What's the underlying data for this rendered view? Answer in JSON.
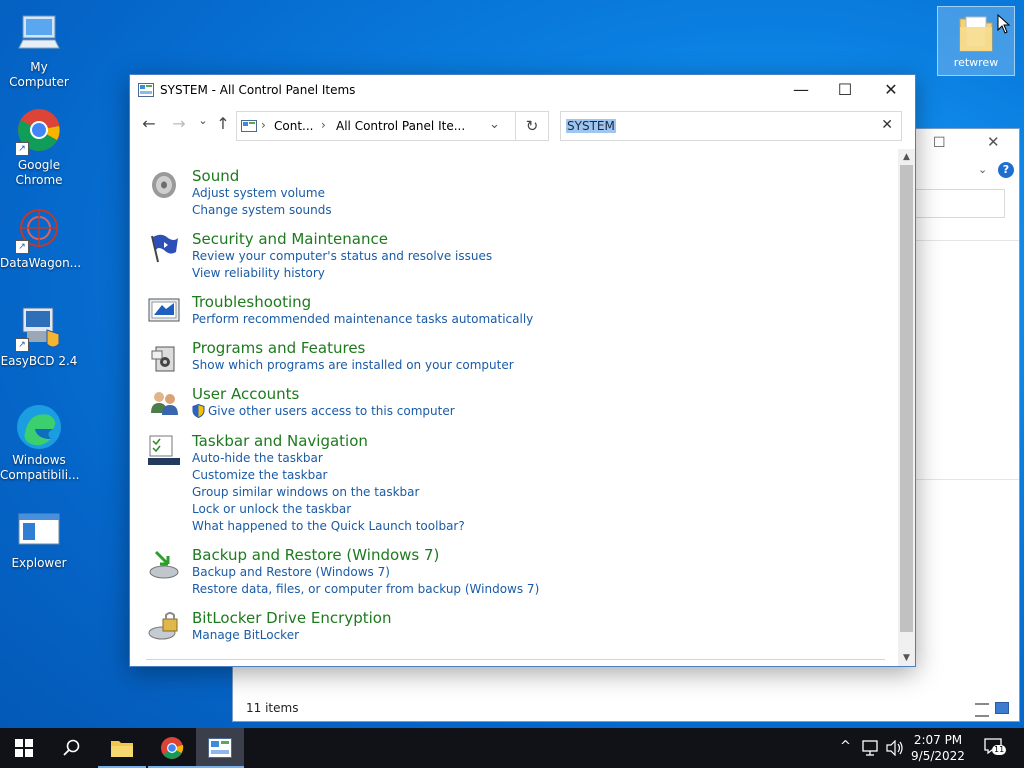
{
  "desktop": {
    "icons": [
      {
        "label": "My Computer",
        "icon": "computer-icon"
      },
      {
        "label": "Google Chrome",
        "icon": "chrome-icon"
      },
      {
        "label": "DataWagon...",
        "icon": "datawagon-icon"
      },
      {
        "label": "EasyBCD 2.4",
        "icon": "easybcd-icon"
      },
      {
        "label": "Windows Compatibili...",
        "icon": "edge-icon"
      },
      {
        "label": "Explower",
        "icon": "explorer-window-icon"
      }
    ],
    "folder": {
      "label": "retwrew",
      "icon": "folder-icon"
    }
  },
  "background_window": {
    "status": "11 items"
  },
  "window": {
    "title": "SYSTEM - All Control Panel Items",
    "minimize": "—",
    "maximize": "☐",
    "close": "✕"
  },
  "nav": {
    "back": "←",
    "forward": "→",
    "recent": "⌄",
    "up": "↑",
    "address_seg1": "Cont...",
    "address_seg2": "All Control Panel Ite...",
    "sep": "›",
    "dropdown": "⌄",
    "refresh": "↻"
  },
  "search": {
    "query": "SYSTEM",
    "clear": "✕"
  },
  "groups": [
    {
      "title": "Sound",
      "icon": "speaker-icon",
      "links": [
        "Adjust system volume",
        "Change system sounds"
      ]
    },
    {
      "title": "Security and Maintenance",
      "icon": "flag-icon",
      "links": [
        "Review your computer's status and resolve issues",
        "View reliability history"
      ]
    },
    {
      "title": "Troubleshooting",
      "icon": "troubleshoot-icon",
      "links": [
        "Perform recommended maintenance tasks automatically"
      ]
    },
    {
      "title": "Programs and Features",
      "icon": "programs-icon",
      "links": [
        "Show which programs are installed on your computer"
      ]
    },
    {
      "title": "User Accounts",
      "icon": "users-icon",
      "links": [
        "Give other users access to this computer"
      ]
    },
    {
      "title": "Taskbar and Navigation",
      "icon": "taskbar-icon",
      "links": [
        "Auto-hide the taskbar",
        "Customize the taskbar",
        "Group similar windows on the taskbar",
        "Lock or unlock the taskbar",
        "What happened to the Quick Launch toolbar?"
      ]
    },
    {
      "title": "Backup and Restore (Windows 7)",
      "icon": "backup-icon",
      "links": [
        "Backup and Restore (Windows 7)",
        "Restore data, files, or computer from backup (Windows 7)"
      ]
    },
    {
      "title": "BitLocker Drive Encryption",
      "icon": "bitlocker-icon",
      "links": [
        "Manage BitLocker"
      ]
    }
  ],
  "taskbar": {
    "time": "2:07 PM",
    "date": "9/5/2022",
    "notification_count": "11",
    "chevron": "^"
  },
  "colors": {
    "group_title": "#1e7a1e",
    "link": "#1a5ba6",
    "selection": "#9ec6f0"
  }
}
